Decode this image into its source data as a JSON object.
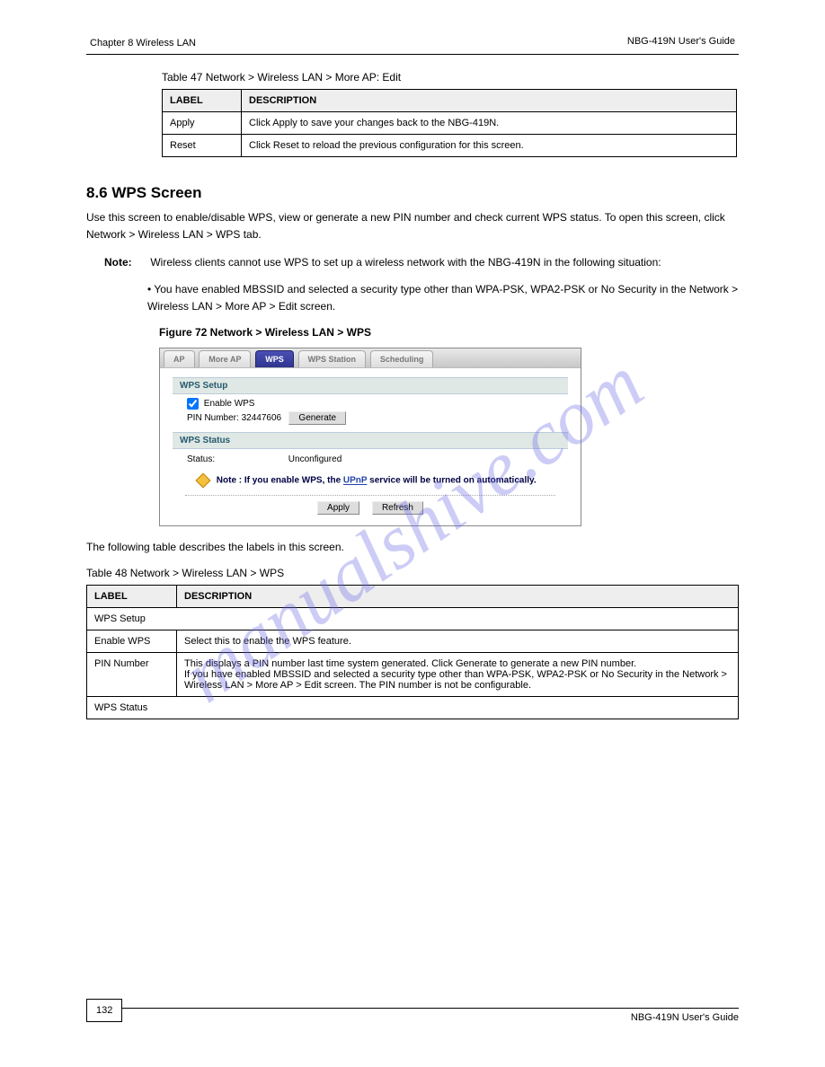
{
  "header": {
    "chapter": "Chapter 8 Wireless LAN",
    "manual": "NBG-419N User's Guide"
  },
  "table47": {
    "caption": "Table 47   Network > Wireless LAN > More AP: Edit",
    "head": {
      "label": "LABEL",
      "desc": "DESCRIPTION"
    },
    "rows": [
      {
        "label": "Apply",
        "desc": "Click Apply to save your changes back to the NBG-419N."
      },
      {
        "label": "Reset",
        "desc": "Click Reset to reload the previous configuration for this screen."
      }
    ]
  },
  "section": {
    "heading": "8.6  WPS Screen",
    "para1": "Use this screen to enable/disable WPS, view or generate a new PIN number and check current WPS status. To open this screen, click Network > Wireless LAN > WPS tab.",
    "note_label": "Note:",
    "note_text": "Wireless clients cannot use WPS to set up a wireless network with the NBG-419N in the following situation:",
    "bullet": "•   You have enabled MBSSID and selected a security type other than WPA-PSK, WPA2-PSK or No Security in the Network > Wireless LAN > More AP > Edit screen.",
    "figure_label": "Figure 72   Network > Wireless LAN > WPS"
  },
  "ui": {
    "tabs": [
      "AP",
      "More AP",
      "WPS",
      "WPS Station",
      "Scheduling"
    ],
    "active_tab": 2,
    "wps_setup_title": "WPS Setup",
    "enable_label": "Enable WPS",
    "enable_checked": true,
    "pin_label": "PIN Number:",
    "pin_value": "32447606",
    "generate": "Generate",
    "wps_status_title": "WPS Status",
    "status_label": "Status:",
    "status_value": "Unconfigured",
    "note_prefix": "Note : If you enable WPS, the ",
    "note_link": "UPnP",
    "note_suffix": " service will be turned on automatically.",
    "apply": "Apply",
    "refresh": "Refresh"
  },
  "table48": {
    "intro": "The following table describes the labels in this screen.",
    "caption": "Table 48   Network > Wireless LAN > WPS",
    "head": {
      "label": "LABEL",
      "desc": "DESCRIPTION"
    },
    "section_row": "WPS Setup",
    "rows": [
      {
        "label": "Enable WPS",
        "desc": "Select this to enable the WPS feature."
      },
      {
        "label": "PIN Number",
        "desc": "This displays a PIN number last time system generated. Click Generate to generate a new PIN number.\nIf you have enabled MBSSID and selected a security type other than WPA-PSK, WPA2-PSK or No Security in the Network > Wireless LAN > More AP > Edit screen. The PIN number is not be configurable."
      }
    ],
    "section_row2": "WPS Status"
  },
  "footer": {
    "page": "132"
  },
  "watermark": "manualshive.com"
}
